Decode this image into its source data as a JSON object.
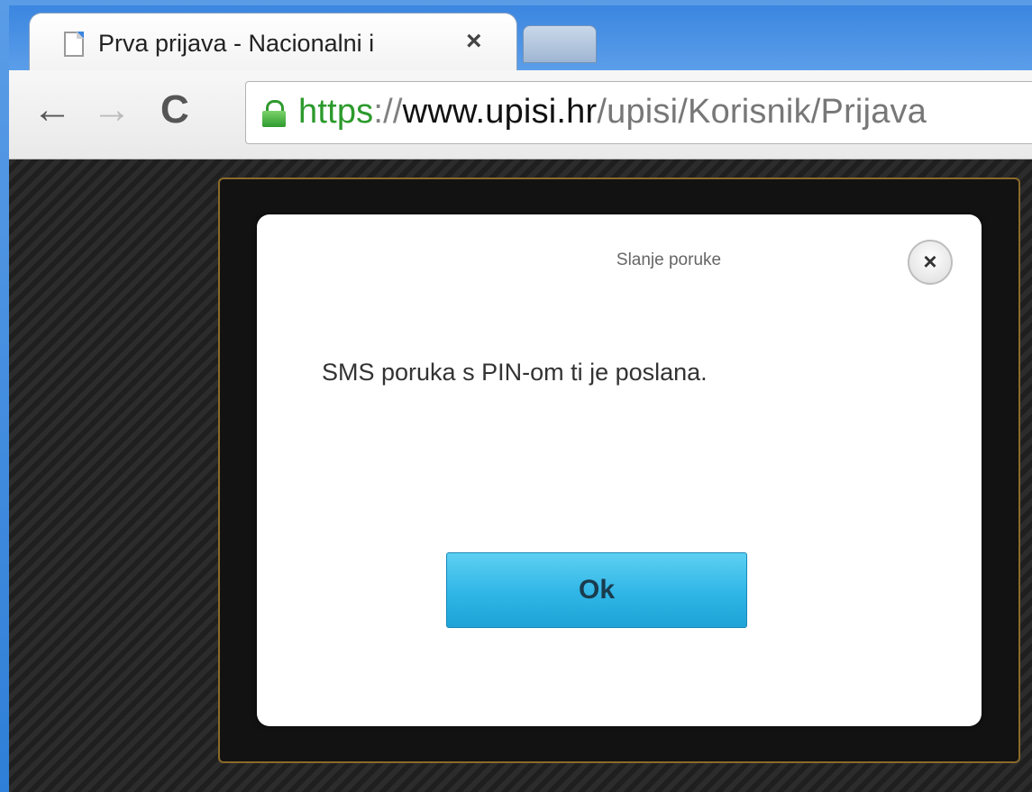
{
  "browser": {
    "tab": {
      "title": "Prva prijava - Nacionalni i",
      "close_glyph": "×",
      "page_icon": "page-icon"
    },
    "nav": {
      "back_glyph": "←",
      "forward_glyph": "→",
      "reload_glyph": "C"
    },
    "address": {
      "scheme": "https",
      "separator": "://",
      "host": "www.upisi.hr",
      "path": "/upisi/Korisnik/Prijava",
      "lock_icon": "lock-icon"
    }
  },
  "modal": {
    "title": "Slanje poruke",
    "close_glyph": "×",
    "message": "SMS poruka s PIN-om ti je poslana.",
    "ok_label": "Ok"
  },
  "colors": {
    "ok_button": "#2fb5e6",
    "url_secure": "#2c9a2c",
    "box_border": "#8a6a2a"
  }
}
